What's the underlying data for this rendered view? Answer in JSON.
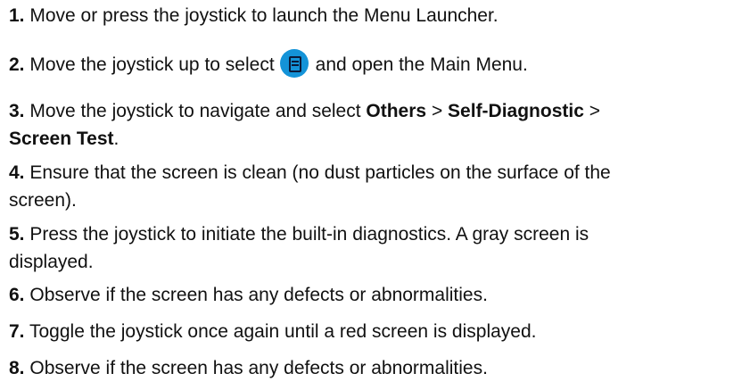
{
  "steps": [
    {
      "number": "1.",
      "text": "Move or press the joystick to launch the Menu Launcher."
    },
    {
      "number": "2.",
      "text_before": "Move the joystick up to select",
      "icon": "main-menu-icon",
      "icon_color": "#1493d8",
      "text_after": "and open the Main Menu."
    },
    {
      "number": "3.",
      "text_before": "Move the joystick to navigate and select",
      "bold1": "Others",
      "sep1": ">",
      "bold2": "Self-Diagnostic",
      "sep2": ">",
      "bold3": "Screen Test",
      "text_after": "."
    },
    {
      "number": "4.",
      "line1": "Ensure that the screen is clean (no dust particles on the surface of the",
      "line2": "screen)."
    },
    {
      "number": "5.",
      "line1": "Press the joystick to initiate the built-in diagnostics. A gray screen is",
      "line2": "displayed."
    },
    {
      "number": "6.",
      "text": "Observe if the screen has any defects or abnormalities."
    },
    {
      "number": "7.",
      "text": "Toggle the joystick once again until a red screen is displayed."
    },
    {
      "number": "8.",
      "text": "Observe if the screen has any defects or abnormalities."
    }
  ]
}
